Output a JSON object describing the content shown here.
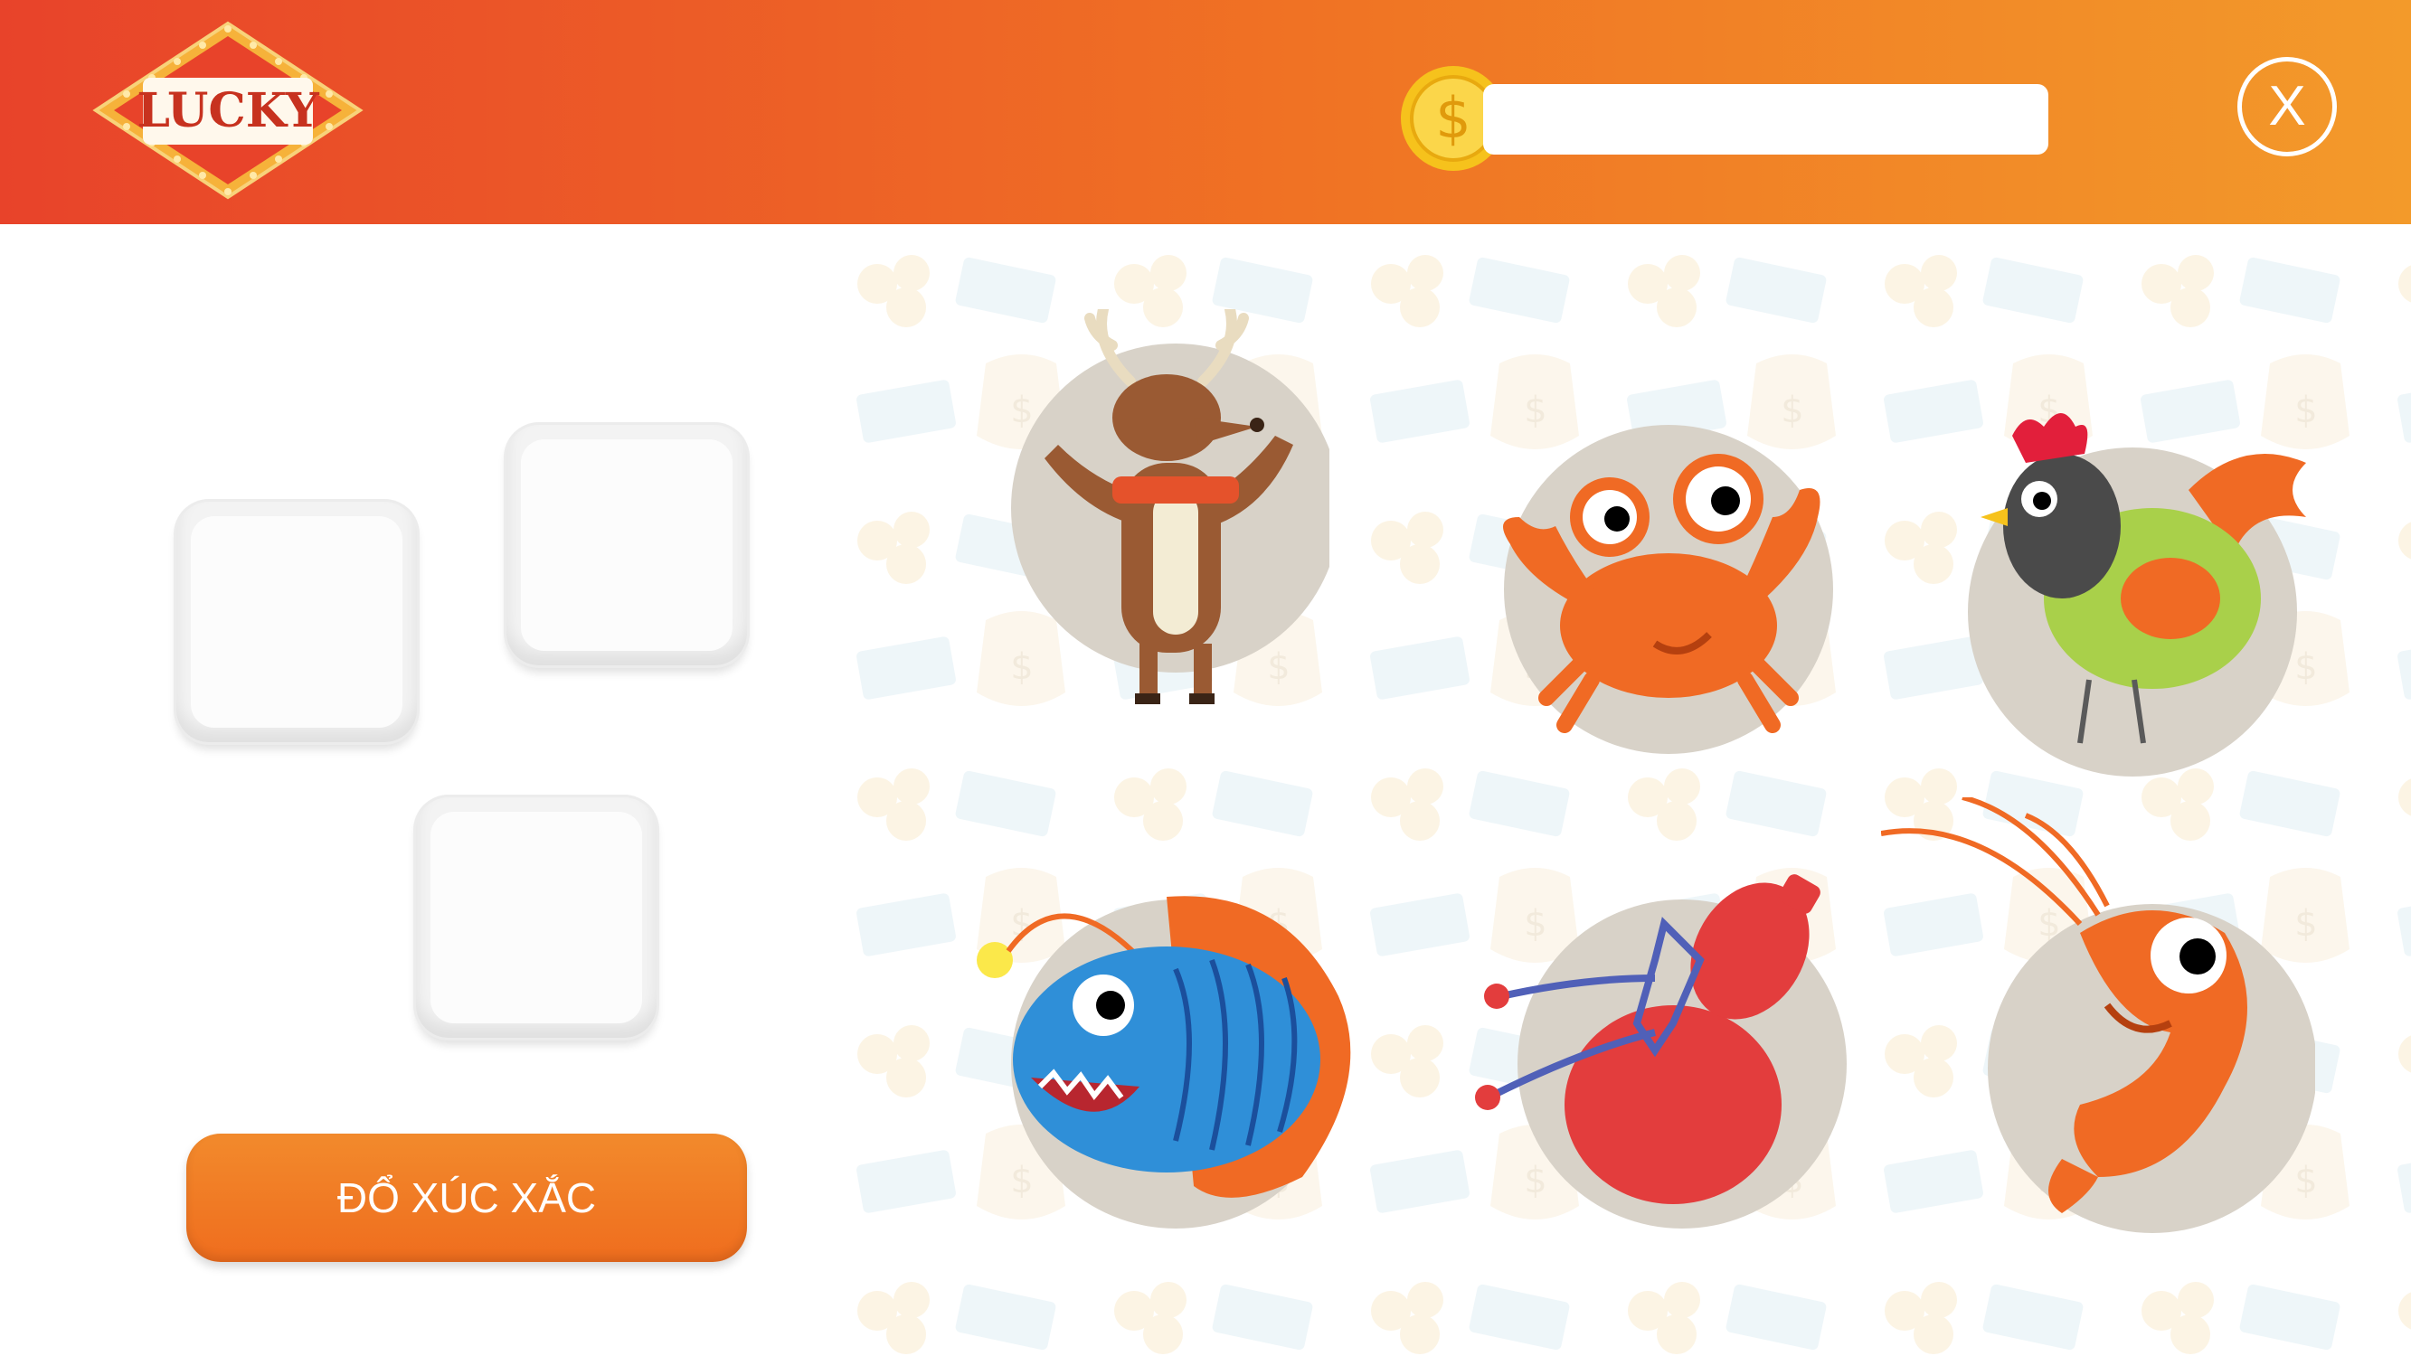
{
  "header": {
    "logo_text": "LUCKY",
    "balance_value": "",
    "close_label": "X"
  },
  "colors": {
    "header_start": "#e8432a",
    "header_end": "#f39a2a",
    "accent_orange": "#f07324",
    "coin_gold": "#f6c21c",
    "tile_bg": "#d8d2c8"
  },
  "dice": [
    {
      "id": "die-1",
      "value": ""
    },
    {
      "id": "die-2",
      "value": ""
    },
    {
      "id": "die-3",
      "value": ""
    }
  ],
  "roll_button": {
    "label": "ĐỔ XÚC XẮC"
  },
  "board": {
    "icons": [
      "deer-icon",
      "crab-icon",
      "rooster-icon",
      "fish-icon",
      "gourd-icon",
      "shrimp-icon"
    ]
  }
}
